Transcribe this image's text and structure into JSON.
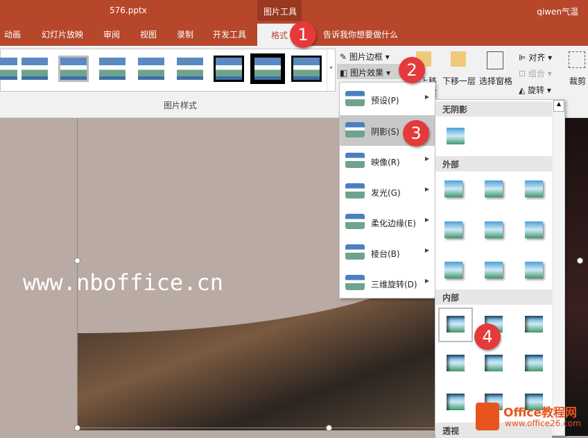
{
  "window": {
    "filename": "576.pptx",
    "context_tab_group": "图片工具",
    "user": "qiwen气温"
  },
  "tabs": [
    "动画",
    "幻灯片放映",
    "审阅",
    "视图",
    "录制",
    "开发工具",
    "格式"
  ],
  "tell_me": "告诉我你想要做什么",
  "ribbon": {
    "picture_border": "图片边框",
    "picture_effects": "图片效果",
    "bring_forward": "上移一层",
    "send_backward": "下移一层",
    "selection_pane": "选择窗格",
    "align": "对齐",
    "group": "组合",
    "rotate": "旋转",
    "crop": "裁剪",
    "group_label": "图片样式"
  },
  "effects_menu": [
    {
      "label": "预设(P)"
    },
    {
      "label": "阴影(S)"
    },
    {
      "label": "映像(R)"
    },
    {
      "label": "发光(G)"
    },
    {
      "label": "柔化边缘(E)"
    },
    {
      "label": "棱台(B)"
    },
    {
      "label": "三维旋转(D)"
    }
  ],
  "shadow_panel": {
    "no_shadow": "无阴影",
    "outer": "外部",
    "inner": "内部",
    "perspective": "透视"
  },
  "slide": {
    "text": "www.nboffice.cn"
  },
  "badges": [
    "1",
    "2",
    "3",
    "4"
  ],
  "watermark": {
    "name": "Office教程网",
    "url": "www.office26.com"
  },
  "colors": {
    "accent": "#b7472a",
    "badge": "#e53a3a"
  }
}
